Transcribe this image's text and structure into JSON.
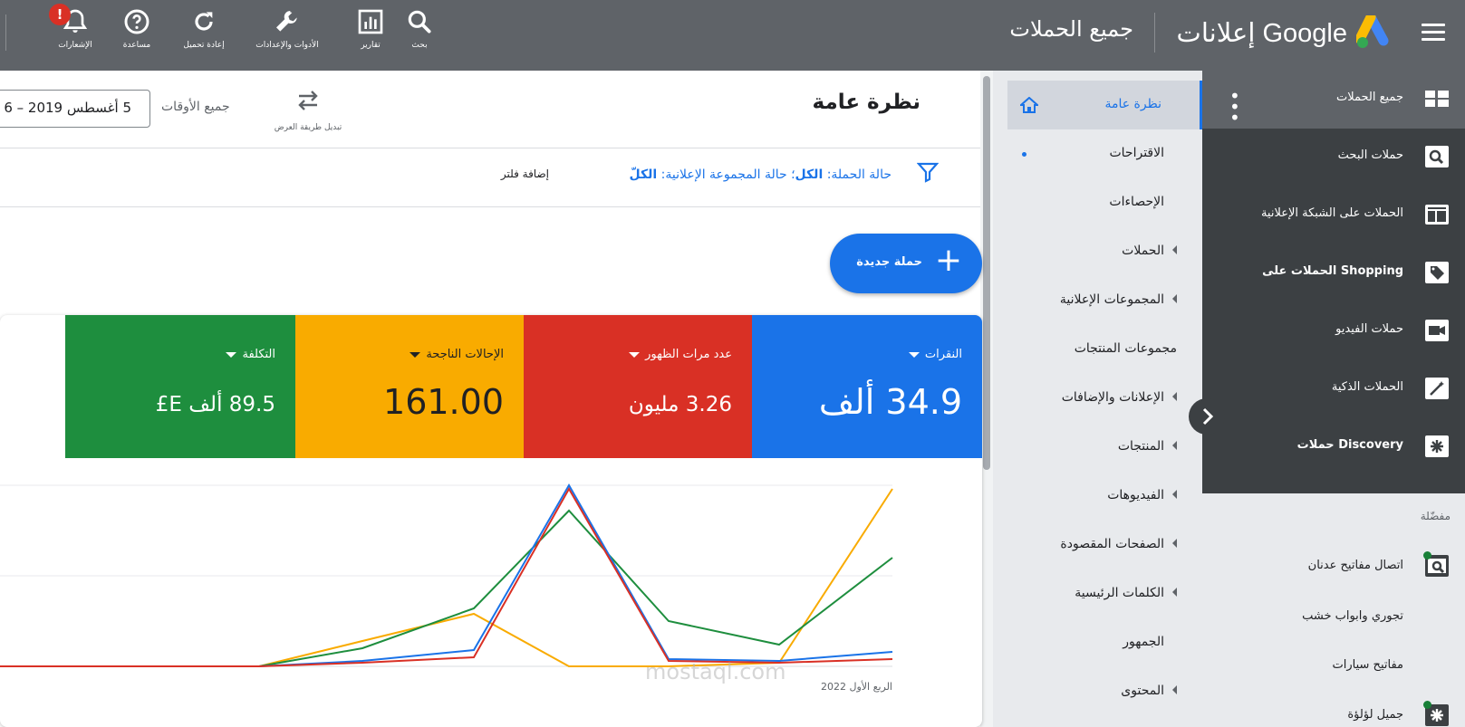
{
  "topbar": {
    "icons": [
      {
        "name": "search-icon",
        "label": "بحث"
      },
      {
        "name": "reports-icon",
        "label": "تقارير"
      },
      {
        "name": "tools-icon",
        "label": "الأدوات والإعدادات"
      },
      {
        "name": "refresh-icon",
        "label": "إعادة تحميل"
      },
      {
        "name": "help-icon",
        "label": "مساعدة"
      },
      {
        "name": "notifications-icon",
        "label": "الإشعارات"
      }
    ],
    "brand": "إعلانات Google",
    "page_title": "جميع الحملات",
    "notification_badge": "!"
  },
  "sidebar": {
    "items": [
      {
        "label": "جميع الحملات"
      },
      {
        "label": "حملات البحث"
      },
      {
        "label": "الحملات على الشبكة الإعلانية"
      },
      {
        "label": "الحملات على Shopping"
      },
      {
        "label": "حملات الفيديو"
      },
      {
        "label": "الحملات الذكية"
      },
      {
        "label": "حملات Discovery"
      }
    ],
    "preferred_label": "مفضّلة",
    "preferred": [
      {
        "label": "اتصال مفاتيح عدنان"
      },
      {
        "label": "تجوري وابواب خشب"
      },
      {
        "label": "مفاتيح سيارات"
      },
      {
        "label": "جميل لؤلؤة"
      }
    ]
  },
  "nav": {
    "items": [
      {
        "label": "نظرة عامة"
      },
      {
        "label": "الاقتراحات"
      },
      {
        "label": "الإحصاءات"
      },
      {
        "label": "الحملات"
      },
      {
        "label": "المجموعات الإعلانية"
      },
      {
        "label": "مجموعات المنتجات"
      },
      {
        "label": "الإعلانات والإضافات"
      },
      {
        "label": "المنتجات"
      },
      {
        "label": "الفيديوهات"
      },
      {
        "label": "الصفحات المقصودة"
      },
      {
        "label": "الكلمات الرئيسية"
      },
      {
        "label": "الجمهور"
      },
      {
        "label": "المحتوى"
      }
    ]
  },
  "main": {
    "title": "نظرة عامة",
    "switch_view": "تبديل طريقة العرض",
    "all_time": "جميع الأوقات",
    "date_range": "5 أغسطس 2019 – 6",
    "filter_prefix1": "حالة الحملة: ",
    "filter_val1": "الكل",
    "filter_prefix2": "؛ حالة المجموعة الإعلانية: ",
    "filter_val2": "الكلّ",
    "add_filter": "إضافة فلتر",
    "new_campaign": "حملة جديدة"
  },
  "metrics": [
    {
      "label": "النقرات",
      "value": "34.9 ألف",
      "color": "#1a73e8"
    },
    {
      "label": "عدد مرات الظهور",
      "value": "3.26 مليون",
      "color": "#d93025"
    },
    {
      "label": "الإحالات الناجحة",
      "value": "161.00",
      "color": "#f9ab00"
    },
    {
      "label": "التكلفة",
      "value": "89.5 ألف E£",
      "color": "#1e8e3e"
    }
  ],
  "chart_data": {
    "type": "line",
    "x_label_visible": "الربع الأول 2022",
    "series": [
      {
        "values": [
          0,
          0,
          0,
          0,
          0.03,
          0.09,
          1.0,
          0.04,
          0.03,
          0.08
        ],
        "color": "#1a73e8"
      },
      {
        "values": [
          0,
          0,
          0,
          0,
          0.02,
          0.05,
          0.98,
          0.03,
          0.02,
          0.04
        ],
        "color": "#d93025"
      },
      {
        "values": [
          0,
          0,
          0,
          0,
          0.14,
          0.29,
          0.0,
          0.0,
          0.02,
          0.98
        ],
        "color": "#f9ab00"
      },
      {
        "values": [
          0,
          0,
          0,
          0,
          0.1,
          0.32,
          0.86,
          0.25,
          0.12,
          0.6
        ],
        "color": "#1e8e3e"
      }
    ],
    "ylim": [
      0,
      1
    ]
  },
  "watermark": "mostaql.com"
}
